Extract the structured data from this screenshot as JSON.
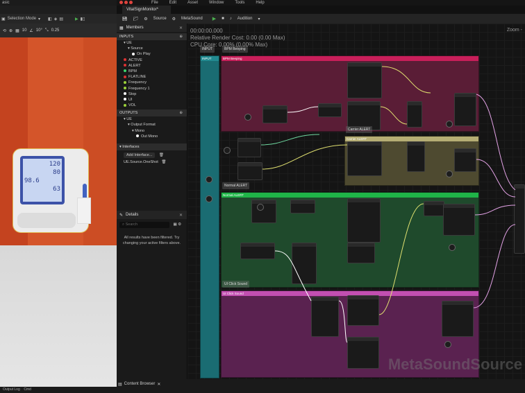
{
  "viewport": {
    "left_tab": "asic",
    "mode_label": "Selection Mode",
    "snap_values": [
      "10",
      "10°",
      "0.25"
    ],
    "monitor_readings": [
      "120",
      "80",
      "98.6",
      "63"
    ],
    "bottom_tabs": [
      "Output Log",
      "Cmd"
    ]
  },
  "menu": {
    "items": [
      "File",
      "Edit",
      "Asset",
      "Window",
      "Tools",
      "Help"
    ]
  },
  "asset_tab": "VitalSignMonitor*",
  "toolbar": {
    "source": "Source",
    "metasound": "MetaSound",
    "audition": "Audition"
  },
  "members": {
    "title": "Members",
    "inputs_header": "INPUTS",
    "inputs": [
      {
        "label": "UE",
        "level": 1,
        "dot": ""
      },
      {
        "label": "Source",
        "level": 2,
        "dot": ""
      },
      {
        "label": "On Play",
        "level": 3,
        "dot": "#ffffff"
      },
      {
        "label": "ACTIVE",
        "level": 1,
        "dot": "#d33"
      },
      {
        "label": "ALERT",
        "level": 1,
        "dot": "#d33"
      },
      {
        "label": "BPM",
        "level": 1,
        "dot": "#3cd36b"
      },
      {
        "label": "FLATLINE",
        "level": 1,
        "dot": "#d33"
      },
      {
        "label": "Frequency",
        "level": 1,
        "dot": "#9bd13a"
      },
      {
        "label": "Frequency 1",
        "level": 1,
        "dot": "#9bd13a"
      },
      {
        "label": "Stop",
        "level": 1,
        "dot": "#ffffff"
      },
      {
        "label": "UI",
        "level": 1,
        "dot": "#ffffff"
      },
      {
        "label": "VOL",
        "level": 1,
        "dot": "#9bd13a"
      }
    ],
    "outputs_header": "OUTPUTS",
    "outputs": [
      {
        "label": "UE",
        "level": 1,
        "dot": ""
      },
      {
        "label": "Output Format",
        "level": 2,
        "dot": ""
      },
      {
        "label": "Mono",
        "level": 3,
        "dot": ""
      },
      {
        "label": "Out Mono",
        "level": 4,
        "dot": "#ffffff"
      }
    ],
    "interfaces_header": "Interfaces",
    "add_interface": "Add Interface...",
    "interface_item": "UE.Source.OneShot"
  },
  "details": {
    "title": "Details",
    "search_placeholder": "Search",
    "message": "All results have been filtered. Try changing your active filters above."
  },
  "graph": {
    "stats": [
      "00:00:00.000",
      "Relative Render Cost: 0.00 (0.00 Max)",
      "CPU Core: 0.00% (0.00% Max)"
    ],
    "zoom": "Zoom -",
    "watermark": "MetaSoundSource",
    "buttons": [
      "INPUT",
      "BPM Beeping",
      "Carrier ALERT",
      "Normal ALERT",
      "UI Click Sound"
    ],
    "comments": [
      "INPUT",
      "BPM Beeping",
      "Carrier ALERT",
      "Normal ALERT",
      "UI Click Sound"
    ]
  },
  "bottom": {
    "content_browser": "Content Browser"
  },
  "colors": {
    "bpm_region": "#6b1f3b",
    "carrier_region": "#5f5a38",
    "normal_region": "#1f5a34",
    "ui_region": "#6b2a5b",
    "input_region": "#1a6c72"
  }
}
